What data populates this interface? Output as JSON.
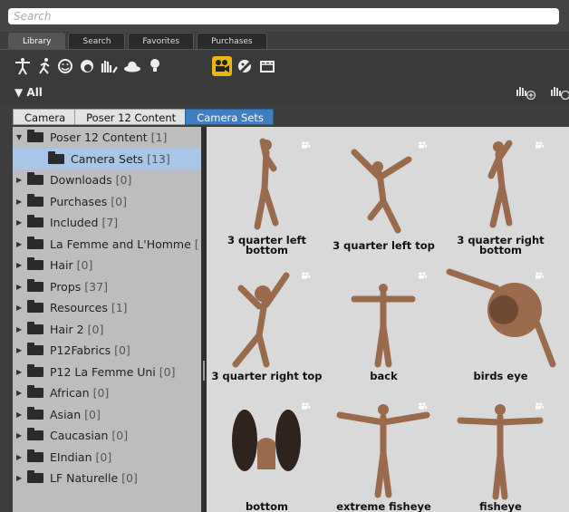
{
  "search": {
    "placeholder": "Search"
  },
  "tabs": [
    {
      "label": "Library",
      "active": true
    },
    {
      "label": "Search",
      "active": false
    },
    {
      "label": "Favorites",
      "active": false
    },
    {
      "label": "Purchases",
      "active": false
    }
  ],
  "icons": [
    "figure-icon",
    "pose-icon",
    "expression-icon",
    "hair-icon",
    "hand-icon",
    "prop-icon",
    "light-icon",
    "camera-icon",
    "materials-icon",
    "scene-icon"
  ],
  "active_icon": "camera-icon",
  "filter": {
    "label": "All"
  },
  "breadcrumb": [
    "Camera",
    "Poser 12 Content",
    "Camera Sets"
  ],
  "tree": [
    {
      "label": "Poser 12 Content",
      "count": "[1]",
      "expanded": true,
      "indent": 0
    },
    {
      "label": "Camera Sets",
      "count": "[13]",
      "selected": true,
      "indent": 1
    },
    {
      "label": "Downloads",
      "count": "[0]",
      "indent": 0
    },
    {
      "label": "Purchases",
      "count": "[0]",
      "indent": 0
    },
    {
      "label": "Included",
      "count": "[7]",
      "indent": 0
    },
    {
      "label": "La Femme and L'Homme",
      "count": "[",
      "indent": 0
    },
    {
      "label": "Hair",
      "count": "[0]",
      "indent": 0
    },
    {
      "label": "Props",
      "count": "[37]",
      "indent": 0
    },
    {
      "label": "Resources",
      "count": "[1]",
      "indent": 0
    },
    {
      "label": "Hair 2",
      "count": "[0]",
      "indent": 0
    },
    {
      "label": "P12Fabrics",
      "count": "[0]",
      "indent": 0
    },
    {
      "label": "P12 La Femme Uni",
      "count": "[0]",
      "indent": 0
    },
    {
      "label": "African",
      "count": "[0]",
      "indent": 0
    },
    {
      "label": "Asian",
      "count": "[0]",
      "indent": 0
    },
    {
      "label": "Caucasian",
      "count": "[0]",
      "indent": 0
    },
    {
      "label": "EIndian",
      "count": "[0]",
      "indent": 0
    },
    {
      "label": "LF Naturelle",
      "count": "[0]",
      "indent": 0
    }
  ],
  "items": [
    {
      "label": "3 quarter left\nbottom"
    },
    {
      "label": "3 quarter left top"
    },
    {
      "label": "3 quarter right\nbottom"
    },
    {
      "label": "3 quarter right top"
    },
    {
      "label": "back"
    },
    {
      "label": "birds eye"
    },
    {
      "label": "bottom"
    },
    {
      "label": "extreme fisheye"
    },
    {
      "label": "fisheye"
    }
  ]
}
